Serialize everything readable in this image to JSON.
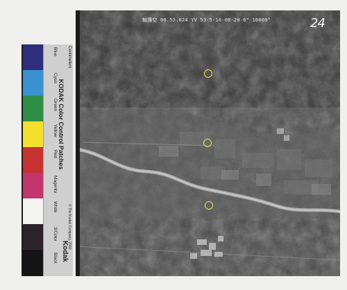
{
  "photo": {
    "header_text": "輸護空 06.53.024 YV 53-5-16-08·20 6\" 10000°",
    "frame_number": "24"
  },
  "color_card": {
    "brand_title": "KODAK Color Control Patches",
    "brand_logo": "Kodak",
    "corner_label": "Centimeters",
    "copyright": "© The Kodak Company, 2000",
    "patches": [
      {
        "name": "Blue",
        "color": "#2f2f7e"
      },
      {
        "name": "Cyan",
        "color": "#3a91cf"
      },
      {
        "name": "Green",
        "color": "#2f8f45"
      },
      {
        "name": "Yellow",
        "color": "#f4df2e"
      },
      {
        "name": "Red",
        "color": "#c63331"
      },
      {
        "name": "Magenta",
        "color": "#c2356d"
      },
      {
        "name": "White",
        "color": "#f4f4f2"
      },
      {
        "name": "3/Color",
        "color": "#2d2429"
      },
      {
        "name": "Black",
        "color": "#141414"
      }
    ]
  }
}
